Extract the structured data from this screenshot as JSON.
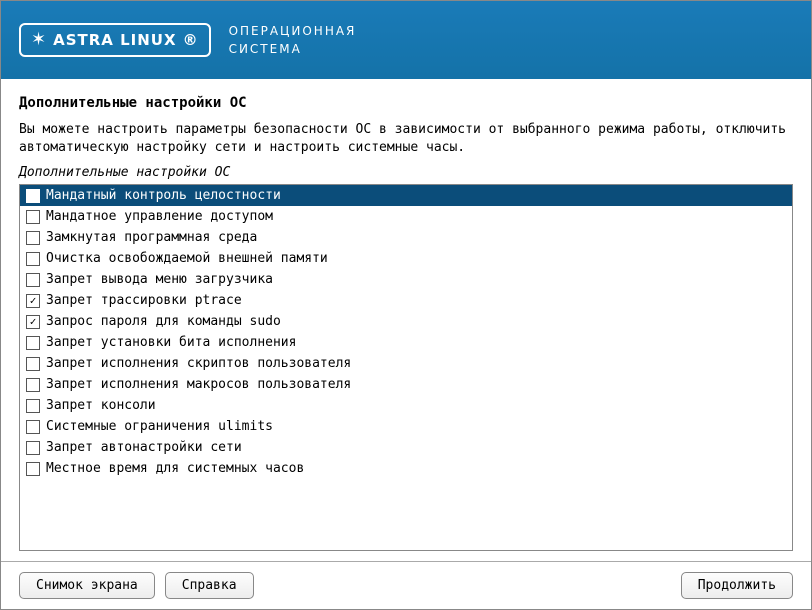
{
  "header": {
    "logo_text": "ASTRA LINUX",
    "logo_suffix": "®",
    "subtitle_line1": "ОПЕРАЦИОННАЯ",
    "subtitle_line2": "СИСТЕМА"
  },
  "page": {
    "title": "Дополнительные настройки ОС",
    "description": "Вы можете настроить параметры безопасности ОС в зависимости от выбранного режима работы, отключить автоматическую настройку сети и настроить системные часы.",
    "section_label": "Дополнительные настройки ОС"
  },
  "options": [
    {
      "label": "Мандатный контроль целостности",
      "checked": false,
      "selected": true
    },
    {
      "label": "Мандатное управление доступом",
      "checked": false,
      "selected": false
    },
    {
      "label": "Замкнутая программная среда",
      "checked": false,
      "selected": false
    },
    {
      "label": "Очистка освобождаемой внешней памяти",
      "checked": false,
      "selected": false
    },
    {
      "label": "Запрет вывода меню загрузчика",
      "checked": false,
      "selected": false
    },
    {
      "label": "Запрет трассировки ptrace",
      "checked": true,
      "selected": false
    },
    {
      "label": "Запрос пароля для команды sudo",
      "checked": true,
      "selected": false
    },
    {
      "label": "Запрет установки бита исполнения",
      "checked": false,
      "selected": false
    },
    {
      "label": "Запрет исполнения скриптов пользователя",
      "checked": false,
      "selected": false
    },
    {
      "label": "Запрет исполнения макросов пользователя",
      "checked": false,
      "selected": false
    },
    {
      "label": "Запрет консоли",
      "checked": false,
      "selected": false
    },
    {
      "label": "Системные ограничения ulimits",
      "checked": false,
      "selected": false
    },
    {
      "label": "Запрет автонастройки сети",
      "checked": false,
      "selected": false
    },
    {
      "label": "Местное время для системных часов",
      "checked": false,
      "selected": false
    }
  ],
  "buttons": {
    "screenshot": "Снимок экрана",
    "help": "Справка",
    "continue": "Продолжить"
  }
}
